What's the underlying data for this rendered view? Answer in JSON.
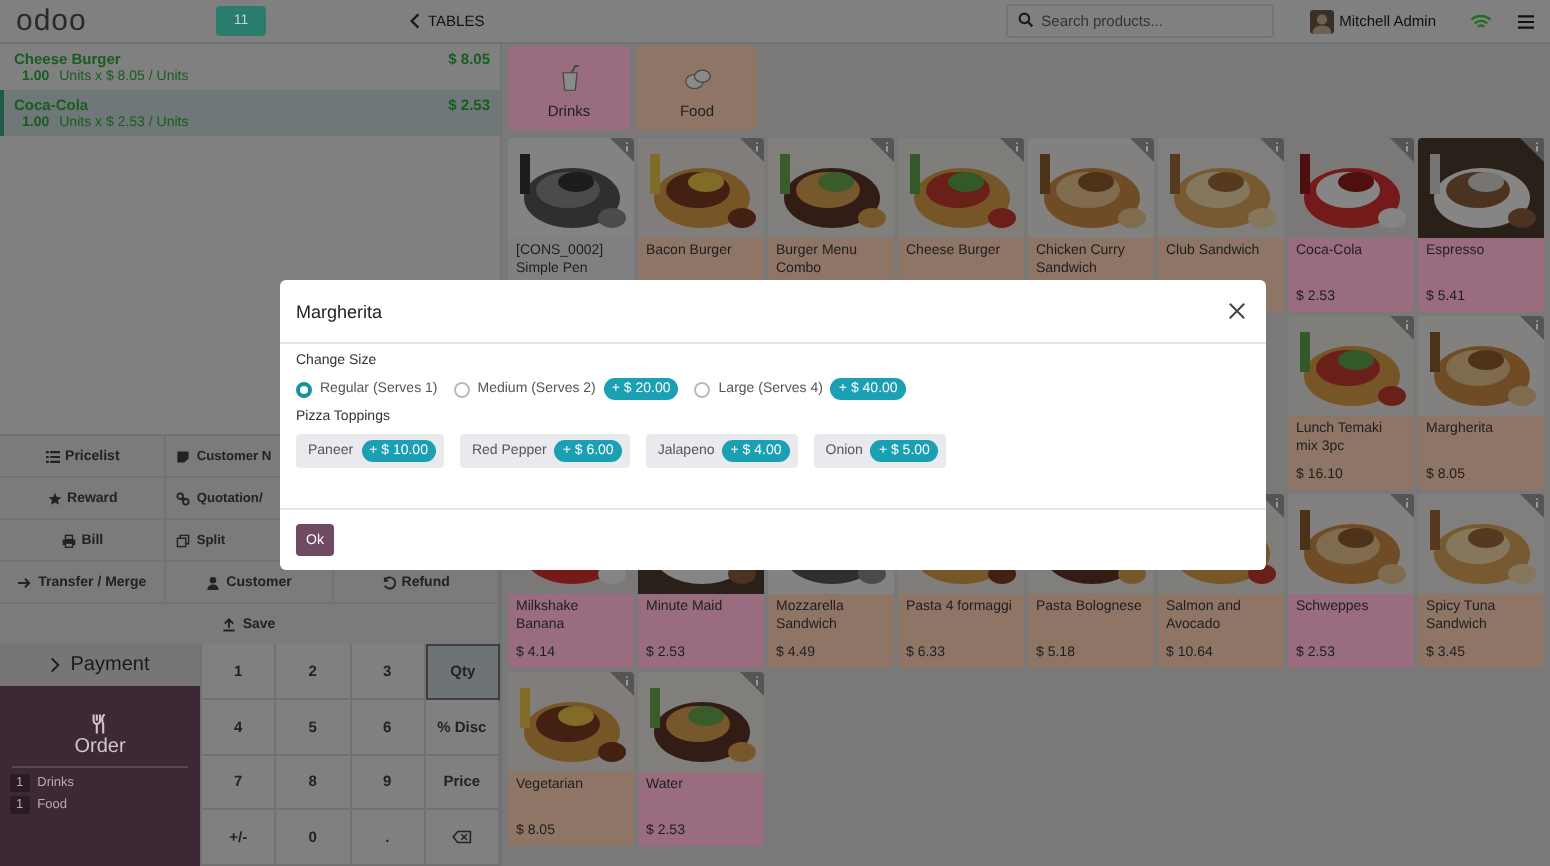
{
  "header": {
    "logo": "odoo",
    "table_number": "11",
    "back_label": "TABLES",
    "search": {
      "placeholder": "Search products..."
    },
    "user": "Mitchell Admin"
  },
  "order_lines": [
    {
      "name": "Cheese Burger",
      "price": "$ 8.05",
      "quantity": "1.00",
      "detail": "Units x $ 8.05 / Units",
      "selected": false
    },
    {
      "name": "Coca-Cola",
      "price": "$ 2.53",
      "quantity": "1.00",
      "detail": "Units x $ 2.53 / Units",
      "selected": true
    }
  ],
  "control_buttons": [
    [
      {
        "label": "Pricelist"
      },
      {
        "label": "Customer N"
      }
    ],
    [
      {
        "label": "Reward"
      },
      {
        "label": "Quotation/"
      }
    ],
    [
      {
        "label": "Bill"
      },
      {
        "label": "Split"
      }
    ],
    [
      {
        "label": "Transfer / Merge"
      },
      {
        "label": "Customer"
      },
      {
        "label": "Refund"
      }
    ],
    [
      {
        "label": "Save"
      }
    ]
  ],
  "payment_label": "Payment",
  "order_tab": {
    "label": "Order",
    "lines": [
      {
        "count": "1",
        "name": "Drinks"
      },
      {
        "count": "1",
        "name": "Food"
      }
    ]
  },
  "numpad": [
    {
      "kind": "digit",
      "label": "1",
      "selected": false
    },
    {
      "kind": "digit",
      "label": "2",
      "selected": false
    },
    {
      "kind": "digit",
      "label": "3",
      "selected": false
    },
    {
      "kind": "mode",
      "label": "Qty",
      "selected": true
    },
    {
      "kind": "digit",
      "label": "4",
      "selected": false
    },
    {
      "kind": "digit",
      "label": "5",
      "selected": false
    },
    {
      "kind": "digit",
      "label": "6",
      "selected": false
    },
    {
      "kind": "mode",
      "label": "% Disc",
      "selected": false
    },
    {
      "kind": "digit",
      "label": "7",
      "selected": false
    },
    {
      "kind": "digit",
      "label": "8",
      "selected": false
    },
    {
      "kind": "digit",
      "label": "9",
      "selected": false
    },
    {
      "kind": "mode",
      "label": "Price",
      "selected": false
    },
    {
      "kind": "digit",
      "label": "+/-",
      "selected": false
    },
    {
      "kind": "digit",
      "label": "0",
      "selected": false
    },
    {
      "kind": "digit",
      "label": ".",
      "selected": false
    },
    {
      "kind": "backspace",
      "selected": false
    }
  ],
  "categories": [
    {
      "name": "Drinks",
      "color": "#9a6c80"
    },
    {
      "name": "Food",
      "color": "#8f7566"
    }
  ],
  "product_rows": [
    [
      {
        "name": "[CONS_0002] Simple Pen",
        "color": "#7e8082"
      },
      {
        "name": "Bacon Burger",
        "color": "#8f7566"
      },
      {
        "name": "Burger Menu Combo",
        "color": "#8f7566"
      },
      {
        "name": "Cheese Burger",
        "color": "#8f7566"
      },
      {
        "name": "Chicken Curry Sandwich",
        "color": "#8f7566"
      },
      {
        "name": "Club Sandwich",
        "color": "#8f7566"
      },
      {
        "name": "Coca-Cola",
        "price": "$ 2.53",
        "color": "#9a6c80"
      },
      {
        "name": "Espresso",
        "price": "$ 5.41",
        "color": "#9a6c80"
      }
    ],
    [
      {
        "name": "Lunch Temaki mix 3pc",
        "price": "$ 16.10",
        "color": "#8f7566"
      },
      {
        "name": "Margherita",
        "price": "$ 8.05",
        "color": "#8f7566"
      }
    ],
    [
      {
        "name": "Milkshake Banana",
        "price": "$ 4.14",
        "color": "#9a6c80"
      },
      {
        "name": "Minute Maid",
        "price": "$ 2.53",
        "color": "#9a6c80"
      },
      {
        "name": "Mozzarella Sandwich",
        "price": "$ 4.49",
        "color": "#8f7566"
      },
      {
        "name": "Pasta 4 formaggi",
        "price": "$ 6.33",
        "color": "#8f7566"
      },
      {
        "name": "Pasta Bolognese",
        "price": "$ 5.18",
        "color": "#8f7566"
      },
      {
        "name": "Salmon and Avocado",
        "price": "$ 10.64",
        "color": "#8f7566"
      },
      {
        "name": "Schweppes",
        "price": "$ 2.53",
        "color": "#9a6c80"
      },
      {
        "name": "Spicy Tuna Sandwich",
        "price": "$ 3.45",
        "color": "#8f7566"
      }
    ],
    [
      {
        "name": "Vegetarian",
        "price": "$ 8.05",
        "color": "#8f7566"
      },
      {
        "name": "Water",
        "price": "$ 2.53",
        "color": "#9a6c80"
      }
    ]
  ],
  "modal": {
    "title": "Margherita",
    "sections": [
      {
        "kind": "radio",
        "title": "Change Size",
        "options": [
          {
            "label": "Regular (Serves 1)",
            "selected": true
          },
          {
            "label": "Medium (Serves 2)",
            "price": "+ $ 20.00",
            "selected": false
          },
          {
            "label": "Large (Serves 4)",
            "price": "+ $ 40.00",
            "selected": false
          }
        ]
      },
      {
        "kind": "chips",
        "title": "Pizza Toppings",
        "options": [
          {
            "label": "Paneer",
            "price": "+ $ 10.00",
            "selected": false
          },
          {
            "label": "Red Pepper",
            "price": "+ $ 6.00",
            "selected": false
          },
          {
            "label": "Jalapeno",
            "price": "+ $ 4.00",
            "selected": false
          },
          {
            "label": "Onion",
            "price": "+ $ 5.00",
            "selected": false
          }
        ]
      }
    ],
    "ok_label": "Ok"
  }
}
